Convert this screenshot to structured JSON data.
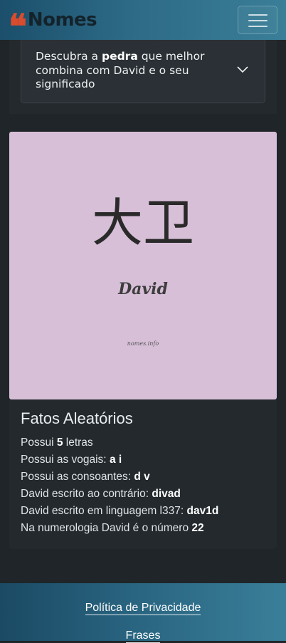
{
  "navbar": {
    "brand_quote": "❝",
    "brand": "Nomes",
    "toggle_icon": "hamburger-menu-icon"
  },
  "accordion": {
    "text_pre": "Descubra a ",
    "text_bold": "pedra",
    "text_post": " que melhor combina com David e o seu significado",
    "icon": "chevron-down-icon"
  },
  "name_image": {
    "kanji": "大卫",
    "name": "David",
    "site": "nomes.info",
    "background": "#d7bfd8"
  },
  "facts": {
    "title": "Fatos Aleatórios",
    "letters_pre": "Possui ",
    "letters_value": "5",
    "letters_post": " letras",
    "vowels_label": "Possui as vogais: ",
    "vowels_value": "a i",
    "consonants_label": "Possui as consoantes: ",
    "consonants_value": "d v",
    "reversed_label": "David escrito ao contrário: ",
    "reversed_value": "divad",
    "leet_label": "David escrito em linguagem l337: ",
    "leet_value": "dav1d",
    "numerology_label": "Na numerologia David é o número ",
    "numerology_value": "22"
  },
  "footer": {
    "privacy": "Política de Privacidade",
    "quotes": "Frases"
  },
  "colors": {
    "accent_red": "#d94c2d",
    "navbar_start": "#1b4f6b",
    "navbar_end": "#3a7e97",
    "page_bg": "#1f2528"
  }
}
